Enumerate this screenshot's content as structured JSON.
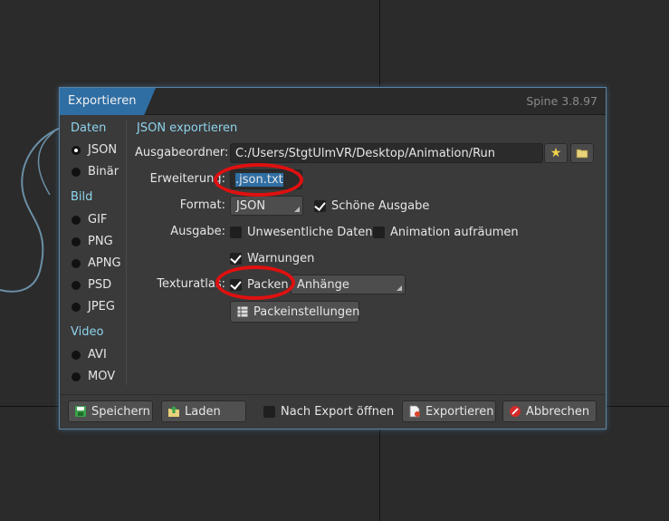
{
  "dialog": {
    "title": "Exportieren",
    "version": "Spine 3.8.97",
    "section_title": "JSON exportieren"
  },
  "sidebar": {
    "categories": [
      {
        "label": "Daten",
        "items": [
          {
            "label": "JSON",
            "selected": true
          },
          {
            "label": "Binär",
            "selected": false
          }
        ]
      },
      {
        "label": "Bild",
        "items": [
          {
            "label": "GIF"
          },
          {
            "label": "PNG"
          },
          {
            "label": "APNG"
          },
          {
            "label": "PSD"
          },
          {
            "label": "JPEG"
          }
        ]
      },
      {
        "label": "Video",
        "items": [
          {
            "label": "AVI"
          },
          {
            "label": "MOV"
          }
        ]
      }
    ]
  },
  "form": {
    "output_folder_label": "Ausgabeordner:",
    "output_folder_value": "C:/Users/StgtUlmVR/Desktop/Animation/Run",
    "extension_label": "Erweiterung:",
    "extension_value": ".json.txt",
    "format_label": "Format:",
    "format_value": "JSON",
    "pretty_print_label": "Schöne Ausgabe",
    "output_label": "Ausgabe:",
    "nonessential_label": "Unwesentliche Daten",
    "cleanup_label": "Animation aufräumen",
    "warnings_label": "Warnungen",
    "texture_atlas_label": "Texturatlas:",
    "pack_label": "Packen",
    "pack_mode_value": "Anhänge",
    "pack_settings_label": "Packeinstellungen"
  },
  "footer": {
    "save_label": "Speichern",
    "load_label": "Laden",
    "open_after_export_label": "Nach Export öffnen",
    "export_label": "Exportieren",
    "cancel_label": "Abbrechen"
  },
  "colors": {
    "accent": "#2f6ea3",
    "category_text": "#8ed4ec",
    "annotation_red": "#e01010"
  }
}
